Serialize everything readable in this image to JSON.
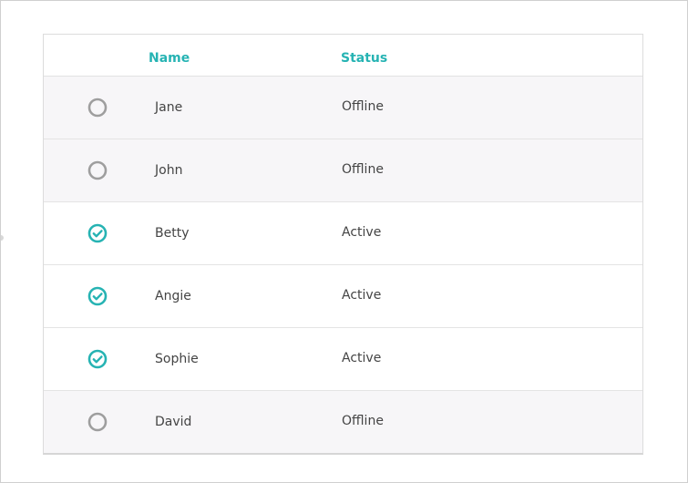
{
  "table": {
    "columns": {
      "name": "Name",
      "status": "Status"
    },
    "rows": [
      {
        "name": "Jane",
        "status": "Offline",
        "checked": false
      },
      {
        "name": "John",
        "status": "Offline",
        "checked": false
      },
      {
        "name": "Betty",
        "status": "Active",
        "checked": true
      },
      {
        "name": "Angie",
        "status": "Active",
        "checked": true
      },
      {
        "name": "Sophie",
        "status": "Active",
        "checked": true
      },
      {
        "name": "David",
        "status": "Offline",
        "checked": false
      }
    ]
  },
  "icons": {
    "checked": "check-circle-icon",
    "unchecked": "empty-circle-icon"
  },
  "colors": {
    "accent": "#26b3b3",
    "unchecked_ring": "#9e9e9e",
    "offline_row_bg": "#f7f6f8",
    "active_row_bg": "#ffffff",
    "text": "#444444"
  }
}
